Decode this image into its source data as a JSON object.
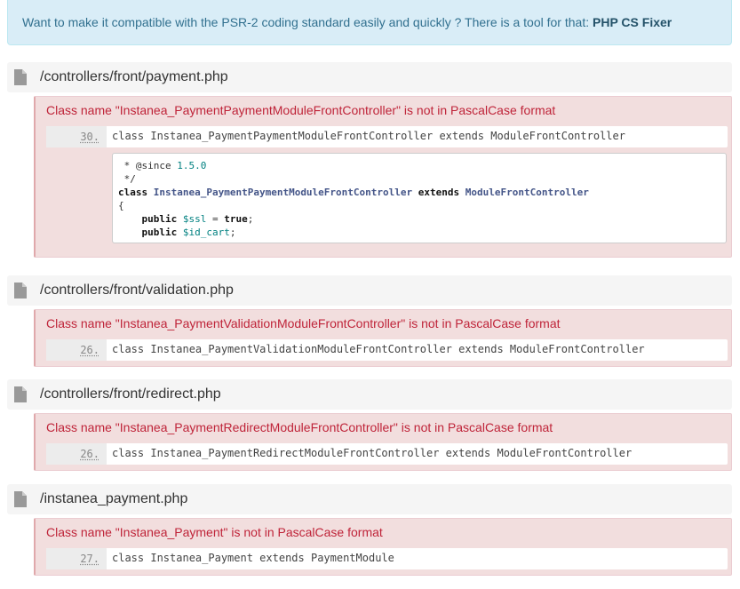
{
  "banner": {
    "text": "Want to make it compatible with the PSR-2 coding standard easily and quickly ? There is a tool for that: ",
    "tool_name": "PHP CS Fixer"
  },
  "icons": {
    "file": "file-icon"
  },
  "colors": {
    "banner_bg": "#d9edf7",
    "error_bg": "#f2dede",
    "error_text": "#bf2439"
  },
  "files": [
    {
      "path": "/controllers/front/payment.php",
      "error": "Class name \"Instanea_PaymentPaymentModuleFrontController\" is not in PascalCase format",
      "line_number": "30.",
      "code": "class Instanea_PaymentPaymentModuleFrontController extends ModuleFrontController",
      "snippet": {
        "line1_prefix": " * @since ",
        "line1_version": "1.5.0",
        "line2": " */",
        "line3_kw": "class",
        "line3_class": "Instanea_PaymentPaymentModuleFrontController",
        "line3_extends": "extends",
        "line3_parent": "ModuleFrontController",
        "line4": "{",
        "line5_kw": "public",
        "line5_var": "$ssl",
        "line5_eq": " = ",
        "line5_val": "true",
        "line5_end": ";",
        "line6_kw": "public",
        "line6_var": "$id_cart",
        "line6_end": ";"
      }
    },
    {
      "path": "/controllers/front/validation.php",
      "error": "Class name \"Instanea_PaymentValidationModuleFrontController\" is not in PascalCase format",
      "line_number": "26.",
      "code": "class Instanea_PaymentValidationModuleFrontController extends ModuleFrontController"
    },
    {
      "path": "/controllers/front/redirect.php",
      "error": "Class name \"Instanea_PaymentRedirectModuleFrontController\" is not in PascalCase format",
      "line_number": "26.",
      "code": "class Instanea_PaymentRedirectModuleFrontController extends ModuleFrontController"
    },
    {
      "path": "/instanea_payment.php",
      "error": "Class name \"Instanea_Payment\" is not in PascalCase format",
      "line_number": "27.",
      "code": "class Instanea_Payment extends PaymentModule"
    }
  ]
}
